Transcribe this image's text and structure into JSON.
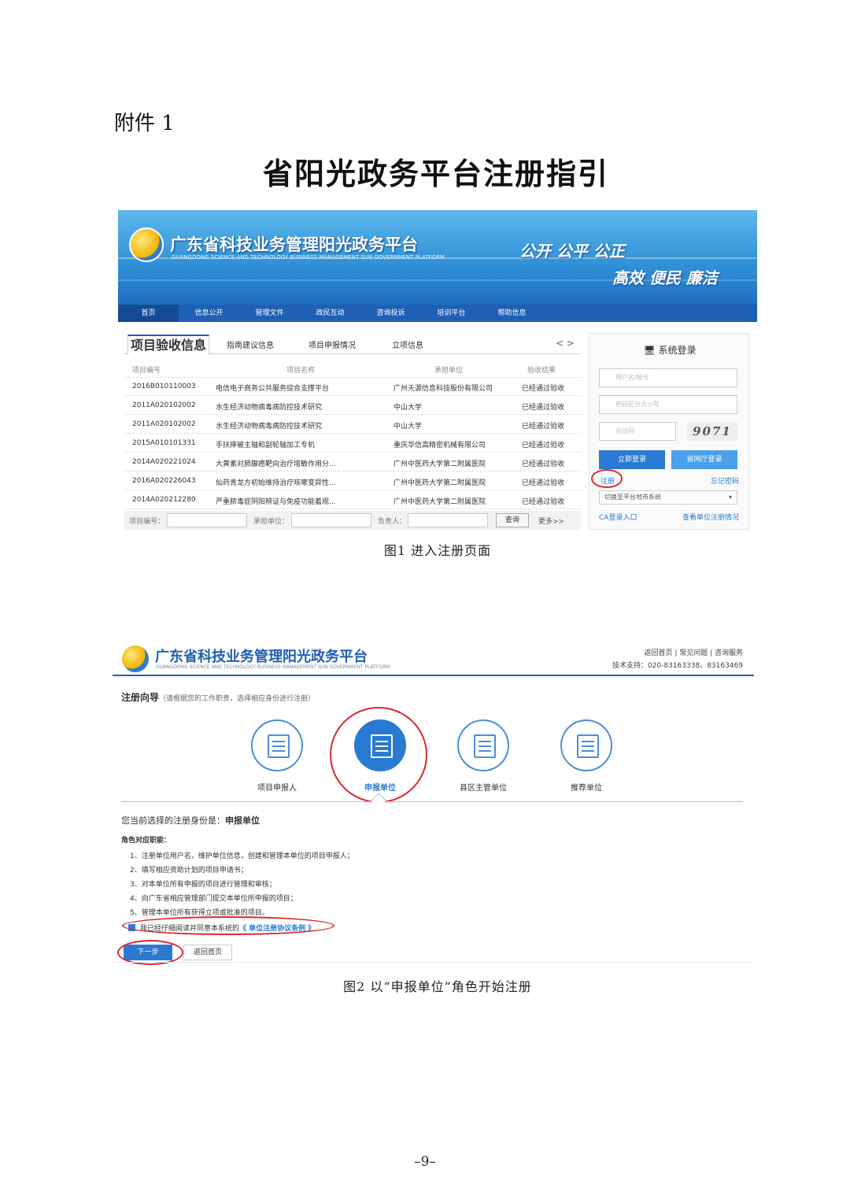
{
  "header": {
    "attachment": "附件 1",
    "title": "省阳光政务平台注册指引"
  },
  "figure1": {
    "banner": {
      "title": "广东省科技业务管理阳光政务平台",
      "subtitle": "GUANGDONG SCIENCE AND TECHNOLOGY BUSINESS MANAGEMENT SUN GOVERNMENT PLATFORM",
      "slogan1": "公开 公平 公正",
      "slogan2": "高效 便民 廉洁"
    },
    "nav": [
      "首页",
      "信息公开",
      "管理文件",
      "政民互动",
      "咨询投诉",
      "培训平台",
      "帮助信息"
    ],
    "tabs": [
      "项目验收信息",
      "指南建议信息",
      "项目申报情况",
      "立项信息"
    ],
    "table": {
      "headers": [
        "项目编号",
        "项目名称",
        "承担单位",
        "验收结果"
      ],
      "rows": [
        [
          "2016B010110003",
          "电信电子商务公共服务综合支撑平台",
          "广州天源信息科技股份有限公司",
          "已经通过验收"
        ],
        [
          "2011A020102002",
          "水生经济动物病毒病防控技术研究",
          "中山大学",
          "已经通过验收"
        ],
        [
          "2011A020102002",
          "水生经济动物病毒病防控技术研究",
          "中山大学",
          "已经通过验收"
        ],
        [
          "2015A010101331",
          "手扶摔被主轴和副轮轴加工专机",
          "重庆华信高精密机械有限公司",
          "已经通过验收"
        ],
        [
          "2014A020221024",
          "大黄素对肺腺癌靶向治疗增敏作用分...",
          "广州中医药大学第二附属医院",
          "已经通过验收"
        ],
        [
          "2016A020226043",
          "仙药青龙方初始维持治疗咳嗽变异性...",
          "广州中医药大学第二附属医院",
          "已经通过验收"
        ],
        [
          "2014A020212280",
          "严重脓毒症阴阳辨证与免疫功能着观...",
          "广州中医药大学第二附属医院",
          "已经通过验收"
        ]
      ]
    },
    "search": {
      "label_code": "项目编号：",
      "label_unit": "承担单位：",
      "label_person": "负责人：",
      "button": "查询",
      "more": "更多>>"
    },
    "login": {
      "title": "系统登录",
      "username_placeholder": "用户名/帐号",
      "password_placeholder": "密码区分大小写",
      "captcha_placeholder": "验证码",
      "captcha_text": "9071",
      "login_button": "立即登录",
      "hall_button": "省网厅登录",
      "register": "注册",
      "forgot": "忘记密码",
      "select": "切换至平台地市系统",
      "ca": "CA登录入口",
      "check": "查看单位注册情况"
    },
    "caption": "图1 进入注册页面"
  },
  "figure2": {
    "title": "广东省科技业务管理阳光政务平台",
    "subtitle": "GUANGDONG SCIENCE AND TECHNOLOGY BUSINESS MANAGEMENT SUN GOVERNMENT PLATFORM",
    "links": "返回首页 | 常见问题 | 咨询服务",
    "support": "技术支持：020-83163338、83163469",
    "guide_title": "注册向导",
    "guide_hint": "（请根据您的工作职责，选择相应身份进行注册）",
    "roles": [
      "项目申报人",
      "申报单位",
      "县区主管单位",
      "推荐单位"
    ],
    "current_prefix": "您当前选择的注册身份是：",
    "current_role": "申报单位",
    "duties_title": "角色对应职能：",
    "duties": [
      "1、注册单位用户名，维护单位信息，创建和管理本单位的项目申报人；",
      "2、填写相应资助计划的项目申请书；",
      "3、对本单位所有申报的项目进行管理和审核；",
      "4、向广东省相应管理部门提交本单位所申报的项目；",
      "5、管理本单位所有获得立项或批准的项目。"
    ],
    "agree_text": "我已经仔细阅读并同意本系统的",
    "agree_link": "《 单位注册协议条例 》",
    "next_button": "下一步",
    "home_button": "返回首页",
    "caption": "图2 以“申报单位”角色开始注册"
  },
  "page_number": "–9–"
}
